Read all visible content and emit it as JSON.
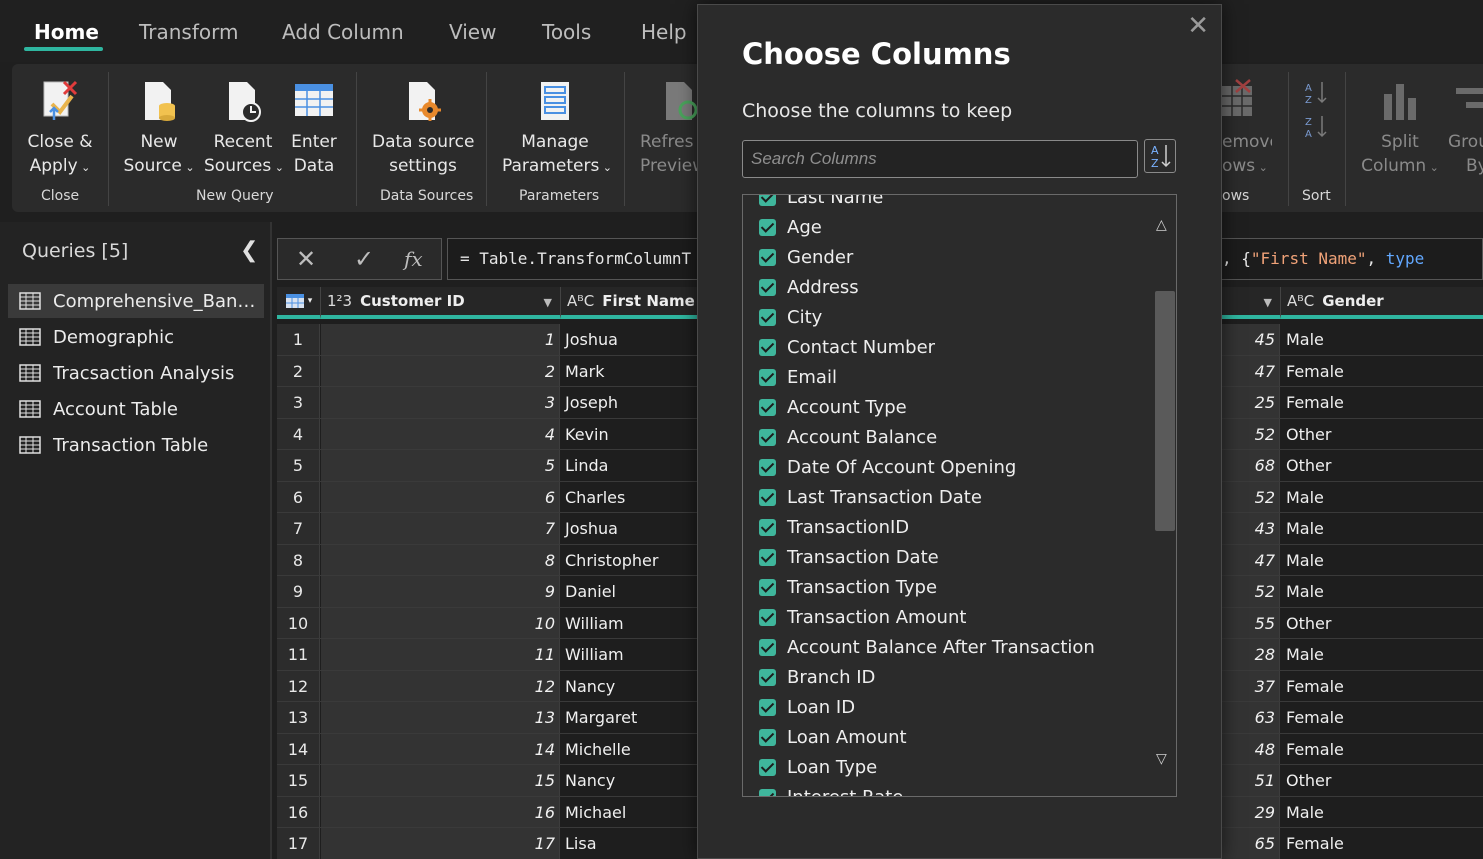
{
  "menu": {
    "tabs": [
      "Home",
      "Transform",
      "Add Column",
      "View",
      "Tools",
      "Help"
    ]
  },
  "ribbon": {
    "close_apply": [
      "Close &",
      "Apply"
    ],
    "new_source": [
      "New",
      "Source"
    ],
    "recent_sources": [
      "Recent",
      "Sources"
    ],
    "enter_data": [
      "Enter",
      "Data"
    ],
    "data_source_settings": [
      "Data source",
      "settings"
    ],
    "manage_parameters": [
      "Manage",
      "Parameters"
    ],
    "refresh_preview": [
      "Refres",
      "Preview"
    ],
    "remove_rows": [
      "emove",
      "ows"
    ],
    "split_column": [
      "Split",
      "Column"
    ],
    "group_by": [
      "Grou",
      "By"
    ],
    "groups": {
      "close": "Close",
      "new_query": "New Query",
      "data_sources": "Data Sources",
      "parameters": "Parameters",
      "rows": "ows",
      "sort": "Sort"
    }
  },
  "queries": {
    "title": "Queries [5]",
    "items": [
      "Comprehensive_Banking...",
      "Demographic",
      "Tracsaction Analysis",
      "Account Table",
      "Transaction Table"
    ],
    "selected_index": 0
  },
  "formula": {
    "text": "= Table.TransformColumnT",
    "tail_prefix": ", {",
    "tail_string": "\"First Name\"",
    "tail_sep": ", ",
    "tail_keyword": "type"
  },
  "grid": {
    "columns": {
      "customer_id": {
        "type_icon": "1²3",
        "label": "Customer ID"
      },
      "first_name": {
        "type_icon": "AᴮC",
        "label": "First Name"
      },
      "gender": {
        "type_icon": "AᴮC",
        "label": "Gender"
      }
    },
    "rows": [
      {
        "n": "1",
        "id": "1",
        "first": "Joshua",
        "age": "45",
        "gender": "Male"
      },
      {
        "n": "2",
        "id": "2",
        "first": "Mark",
        "age": "47",
        "gender": "Female"
      },
      {
        "n": "3",
        "id": "3",
        "first": "Joseph",
        "age": "25",
        "gender": "Female"
      },
      {
        "n": "4",
        "id": "4",
        "first": "Kevin",
        "age": "52",
        "gender": "Other"
      },
      {
        "n": "5",
        "id": "5",
        "first": "Linda",
        "age": "68",
        "gender": "Other"
      },
      {
        "n": "6",
        "id": "6",
        "first": "Charles",
        "age": "52",
        "gender": "Male"
      },
      {
        "n": "7",
        "id": "7",
        "first": "Joshua",
        "age": "43",
        "gender": "Male"
      },
      {
        "n": "8",
        "id": "8",
        "first": "Christopher",
        "age": "47",
        "gender": "Male"
      },
      {
        "n": "9",
        "id": "9",
        "first": "Daniel",
        "age": "52",
        "gender": "Male"
      },
      {
        "n": "10",
        "id": "10",
        "first": "William",
        "age": "55",
        "gender": "Other"
      },
      {
        "n": "11",
        "id": "11",
        "first": "William",
        "age": "28",
        "gender": "Male"
      },
      {
        "n": "12",
        "id": "12",
        "first": "Nancy",
        "age": "37",
        "gender": "Female"
      },
      {
        "n": "13",
        "id": "13",
        "first": "Margaret",
        "age": "63",
        "gender": "Female"
      },
      {
        "n": "14",
        "id": "14",
        "first": "Michelle",
        "age": "48",
        "gender": "Female"
      },
      {
        "n": "15",
        "id": "15",
        "first": "Nancy",
        "age": "51",
        "gender": "Other"
      },
      {
        "n": "16",
        "id": "16",
        "first": "Michael",
        "age": "29",
        "gender": "Male"
      },
      {
        "n": "17",
        "id": "17",
        "first": "Lisa",
        "age": "65",
        "gender": "Female"
      }
    ]
  },
  "dialog": {
    "title": "Choose Columns",
    "subtitle": "Choose the columns to keep",
    "search_placeholder": "Search Columns",
    "columns": [
      {
        "label": "Last Name",
        "checked": true
      },
      {
        "label": "Age",
        "checked": true
      },
      {
        "label": "Gender",
        "checked": true
      },
      {
        "label": "Address",
        "checked": true
      },
      {
        "label": "City",
        "checked": true
      },
      {
        "label": "Contact Number",
        "checked": true
      },
      {
        "label": "Email",
        "checked": true
      },
      {
        "label": "Account Type",
        "checked": true
      },
      {
        "label": "Account Balance",
        "checked": true
      },
      {
        "label": "Date Of Account Opening",
        "checked": true
      },
      {
        "label": "Last Transaction Date",
        "checked": true
      },
      {
        "label": "TransactionID",
        "checked": true
      },
      {
        "label": "Transaction Date",
        "checked": true
      },
      {
        "label": "Transaction Type",
        "checked": true
      },
      {
        "label": "Transaction Amount",
        "checked": true
      },
      {
        "label": "Account Balance After Transaction",
        "checked": true
      },
      {
        "label": "Branch ID",
        "checked": true
      },
      {
        "label": "Loan ID",
        "checked": true
      },
      {
        "label": "Loan Amount",
        "checked": true
      },
      {
        "label": "Loan Type",
        "checked": true
      },
      {
        "label": "Interest Rate",
        "checked": true
      }
    ]
  },
  "colors": {
    "accent": "#2fb6a0",
    "checkbox": "#3fb69c",
    "background": "#1f1f1f"
  }
}
